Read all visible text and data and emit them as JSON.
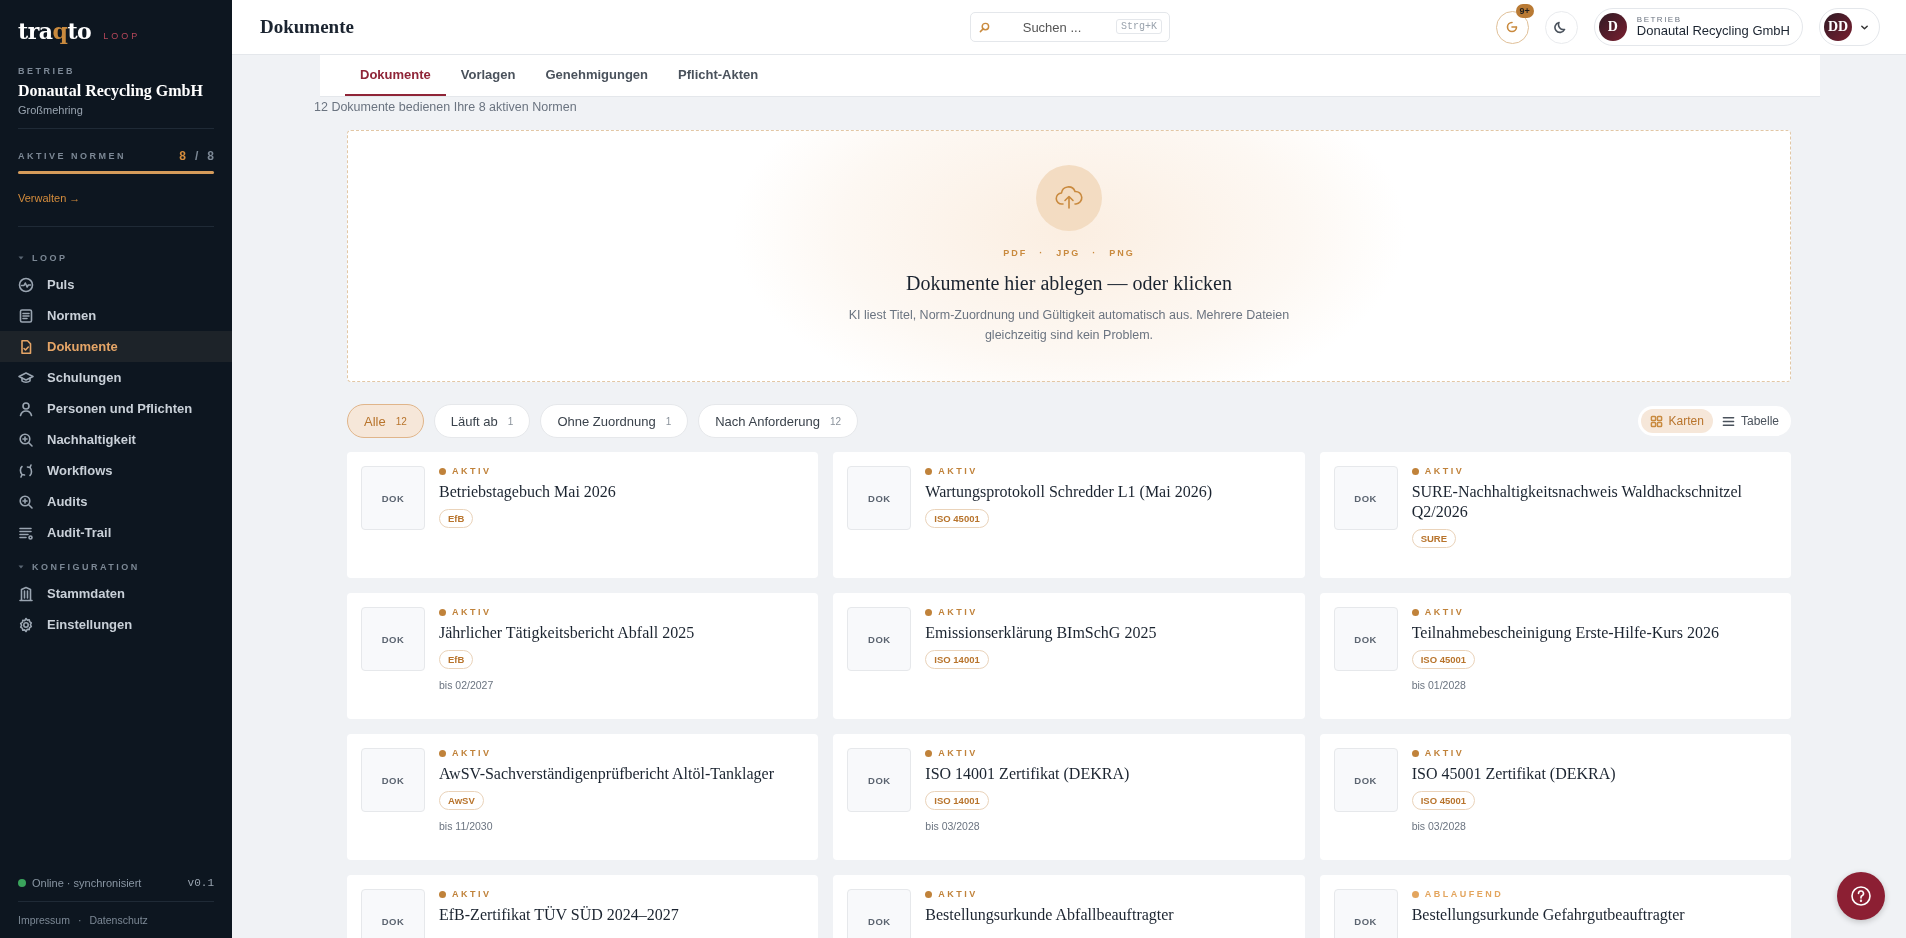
{
  "sidebar": {
    "logo": {
      "parts": [
        {
          "text": "tra",
          "accent": false
        },
        {
          "text": "q",
          "accent": true
        },
        {
          "text": "to",
          "accent": false
        }
      ],
      "suffix": "LOOP"
    },
    "company_label": "BETRIEB",
    "company": "Donautal Recycling GmbH",
    "location": "Großmehring",
    "normen": {
      "label": "AKTIVE NORMEN",
      "count": "8",
      "separator": "/",
      "total": "8",
      "level": 1
    },
    "manage_link": "Verwalten →",
    "sections": [
      {
        "title": "LOOP",
        "expanded": true,
        "items": [
          {
            "label": "Puls",
            "selected": false
          },
          {
            "label": "Normen",
            "selected": false
          },
          {
            "label": "Dokumente",
            "selected": true
          },
          {
            "label": "Schulungen",
            "selected": false
          },
          {
            "label": "Personen und Pflichten",
            "selected": false
          },
          {
            "label": "Nachhaltigkeit",
            "selected": false
          },
          {
            "label": "Workflows",
            "selected": false
          },
          {
            "label": "Audits",
            "selected": false
          },
          {
            "label": "Audit-Trail",
            "selected": false
          }
        ]
      },
      {
        "title": "KONFIGURATION",
        "expanded": true,
        "items": [
          {
            "label": "Stammdaten",
            "selected": false
          },
          {
            "label": "Einstellungen",
            "selected": false
          }
        ]
      }
    ],
    "status": {
      "text": "Online · synchronisiert",
      "online": true
    },
    "version": "v0.1",
    "footer_links": [
      "Impressum",
      "Datenschutz"
    ],
    "footer_separator": "·"
  },
  "header": {
    "title": "Dokumente",
    "search": {
      "placeholder": "Suchen ...",
      "shortcut": "Strg+K"
    },
    "notifications_badge": "9+",
    "company_switch": {
      "avatar": "D",
      "label": "BETRIEB",
      "name": "Donautal Recycling GmbH"
    },
    "user_avatar": "DD"
  },
  "tabs": [
    {
      "label": "Dokumente",
      "selected": true
    },
    {
      "label": "Vorlagen",
      "selected": false
    },
    {
      "label": "Genehmigungen",
      "selected": false
    },
    {
      "label": "Pflicht-Akten",
      "selected": false
    }
  ],
  "summary": "12 Dokumente bedienen Ihre 8 aktiven Normen",
  "upload": {
    "formats": [
      "PDF",
      "JPG",
      "PNG"
    ],
    "format_separator": "·",
    "title": "Dokumente hier ablegen — oder klicken",
    "description": "KI liest Titel, Norm-Zuordnung und Gültigkeit automatisch aus. Mehrere Dateien gleichzeitig sind kein Problem."
  },
  "filters": [
    {
      "label": "Alle",
      "count": "12",
      "selected": true
    },
    {
      "label": "Läuft ab",
      "count": "1",
      "selected": false
    },
    {
      "label": "Ohne Zuordnung",
      "count": "1",
      "selected": false
    },
    {
      "label": "Nach Anforderung",
      "count": "12",
      "selected": false
    }
  ],
  "views": [
    {
      "label": "Karten",
      "selected": true
    },
    {
      "label": "Tabelle",
      "selected": false
    }
  ],
  "documents": [
    {
      "thumb": "DOK",
      "status": "AKTIV",
      "color": "#c0823a",
      "title": "Betriebstagebuch Mai 2026",
      "tag": "EfB"
    },
    {
      "thumb": "DOK",
      "status": "AKTIV",
      "color": "#c0823a",
      "title": "Wartungsprotokoll Schredder L1 (Mai 2026)",
      "tag": "ISO 45001"
    },
    {
      "thumb": "DOK",
      "status": "AKTIV",
      "color": "#c0823a",
      "title": "SURE-Nachhaltigkeitsnachweis Waldhackschnitzel Q2/2026",
      "tag": "SURE"
    },
    {
      "thumb": "DOK",
      "status": "AKTIV",
      "color": "#c0823a",
      "title": "Jährlicher Tätigkeitsbericht Abfall 2025",
      "tag": "EfB",
      "valid_until": "bis 02/2027"
    },
    {
      "thumb": "DOK",
      "status": "AKTIV",
      "color": "#c0823a",
      "title": "Emissionserklärung BImSchG 2025",
      "tag": "ISO 14001"
    },
    {
      "thumb": "DOK",
      "status": "AKTIV",
      "color": "#c0823a",
      "title": "Teilnahmebescheinigung Erste-Hilfe-Kurs 2026",
      "tag": "ISO 45001",
      "valid_until": "bis 01/2028"
    },
    {
      "thumb": "DOK",
      "status": "AKTIV",
      "color": "#c0823a",
      "title": "AwSV-Sachverständigenprüfbericht Altöl-Tanklager",
      "tag": "AwSV",
      "valid_until": "bis 11/2030"
    },
    {
      "thumb": "DOK",
      "status": "AKTIV",
      "color": "#c0823a",
      "title": "ISO 14001 Zertifikat (DEKRA)",
      "tag": "ISO 14001",
      "valid_until": "bis 03/2028"
    },
    {
      "thumb": "DOK",
      "status": "AKTIV",
      "color": "#c0823a",
      "title": "ISO 45001 Zertifikat (DEKRA)",
      "tag": "ISO 45001",
      "valid_until": "bis 03/2028"
    },
    {
      "thumb": "DOK",
      "status": "AKTIV",
      "color": "#c0823a",
      "title": "EfB-Zertifikat TÜV SÜD 2024–2027"
    },
    {
      "thumb": "DOK",
      "status": "AKTIV",
      "color": "#c0823a",
      "title": "Bestellungsurkunde Abfallbeauftragter"
    },
    {
      "thumb": "DOK",
      "status": "ABLAUFEND",
      "color": "#e3a55e",
      "title": "Bestellungsurkunde Gefahrgutbeauftragter"
    }
  ]
}
